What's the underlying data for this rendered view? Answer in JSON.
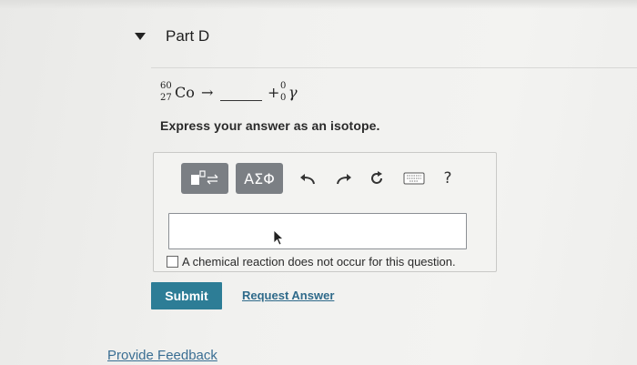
{
  "part": {
    "title": "Part D"
  },
  "equation": {
    "reactant": {
      "mass": "60",
      "atomic": "27",
      "symbol": "Co"
    },
    "arrow": "→",
    "plus": "+",
    "product": {
      "mass": "0",
      "atomic": "0",
      "symbol": "γ"
    }
  },
  "prompt": "Express your answer as an isotope.",
  "toolbar": {
    "template_label": "■□⇌",
    "greek_label": "ΑΣΦ",
    "help_label": "?"
  },
  "answer_input": {
    "value": ""
  },
  "no_reaction_checkbox": {
    "label": "A chemical reaction does not occur for this question.",
    "checked": false
  },
  "submit_label": "Submit",
  "request_answer_label": "Request Answer",
  "feedback_label": "Provide Feedback",
  "colors": {
    "submit": "#2d7d96",
    "toolbar": "#7b7f84",
    "link": "#2f6a8a"
  }
}
